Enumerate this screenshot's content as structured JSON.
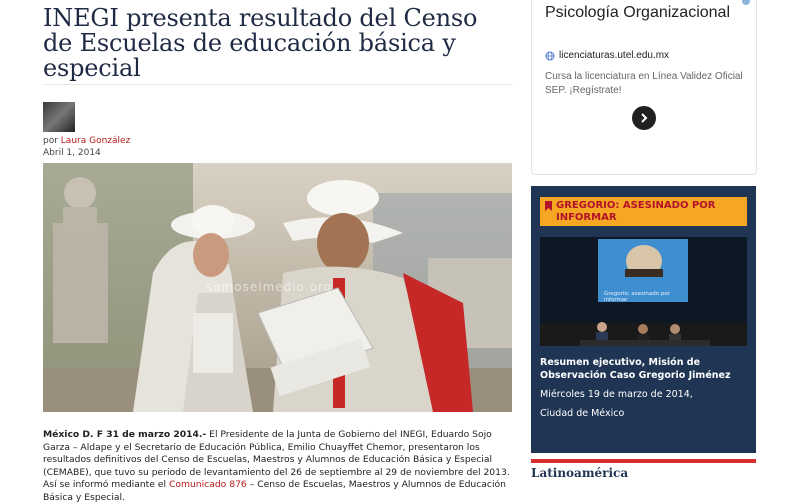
{
  "article": {
    "title": "INEGI presenta resultado del Censo de Escuelas de educación básica y especial",
    "byline_prefix": "por",
    "author": "Laura González",
    "date": "Abril 1, 2014",
    "watermark": "somoselmedio.org",
    "lead": "México D. F 31 de marzo 2014.-",
    "body": " El Presidente de la Junta de Gobierno del INEGI, Eduardo Sojo Garza – Aldape y el Secretario de Educación Pública, Emilio Chuayffet Chemor, presentaron los resultados definitivos del Censo de Escuelas, Maestros y Alumnos de Educación Básica y Especial (CEMABE), que tuvo su periodo de levantamiento del 26 de septiembre al 29 de noviembre del 2013. Así se informó mediante el ",
    "body_link": "Comunicado 876",
    "body_tail": " – Censo de Escuelas, Maestros y Alumnos de Educación Básica y Especial."
  },
  "ad": {
    "title": "Psicología Organizacional",
    "url": "licenciaturas.utel.edu.mx",
    "description": "Cursa la licenciatura en Línea Validez Oficial SEP. ¡Regístrate!",
    "choice_icon": "ad-choices-icon",
    "arrow_icon": "chevron-right-icon"
  },
  "feature": {
    "header": "GREGORIO: ASESINADO POR INFORMAR",
    "bookmark_icon": "bookmark-icon",
    "caption": "Resumen ejecutivo, Misión de Observación Caso Gregorio Jiménez",
    "date": "Miércoles 19 de marzo de 2014,",
    "place": "Ciudad de México",
    "screen_text": "Gregorio: asesinado por informar"
  },
  "sidebar": {
    "section_title": "Latinoamérica"
  },
  "colors": {
    "title": "#1f2a44",
    "author_link": "#b71c1c",
    "feature_bg": "#1f3553",
    "feature_header": "#f5a623",
    "feature_header_text": "#b3122b",
    "rule_red": "#d62d2d"
  }
}
